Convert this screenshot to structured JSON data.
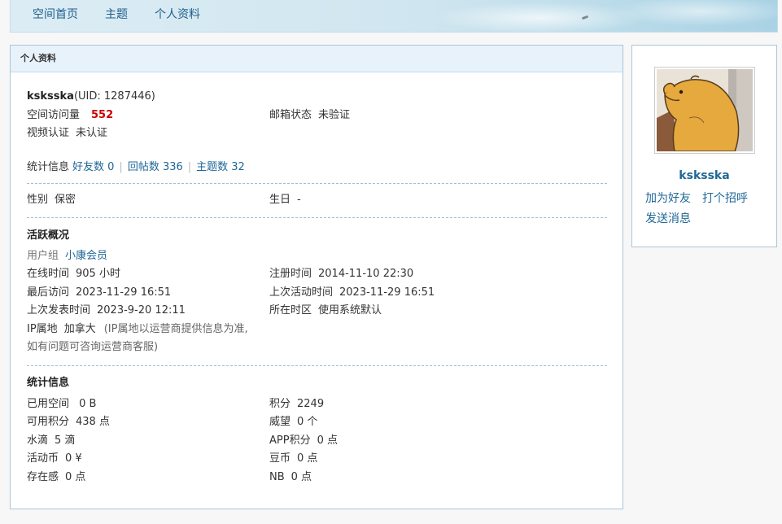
{
  "nav": {
    "items": [
      "空间首页",
      "主题",
      "个人资料"
    ]
  },
  "panel": {
    "title": "个人资料"
  },
  "user": {
    "name": "ksksska",
    "uid": "(UID: 1287446)",
    "visits_label": "空间访问量",
    "visits": "552",
    "email_label": "邮箱状态",
    "email_value": "未验证",
    "video_label": "视频认证",
    "video_value": "未认证"
  },
  "stats_line": {
    "label": "统计信息",
    "friends": "好友数 0",
    "replies": "回帖数 336",
    "topics": "主题数 32",
    "sep": "|"
  },
  "basic": {
    "gender_label": "性别",
    "gender_value": "保密",
    "birthday_label": "生日",
    "birthday_value": "-"
  },
  "activity": {
    "title": "活跃概况",
    "group_label": "用户组",
    "group_value": "小康会员",
    "online_label": "在线时间",
    "online_value": "905 小时",
    "register_label": "注册时间",
    "register_value": "2014-11-10 22:30",
    "last_visit_label": "最后访问",
    "last_visit_value": "2023-11-29 16:51",
    "last_active_label": "上次活动时间",
    "last_active_value": "2023-11-29 16:51",
    "last_post_label": "上次发表时间",
    "last_post_value": "2023-9-20 12:11",
    "timezone_label": "所在时区",
    "timezone_value": "使用系统默认",
    "ip_label": "IP属地",
    "ip_value": "加拿大",
    "ip_note_1": "(IP属地以运营商提供信息为准,",
    "ip_note_2": "如有问题可咨询运营商客服)"
  },
  "statistics": {
    "title": "统计信息",
    "rows": [
      {
        "l_label": "已用空间",
        "l_value": " 0 B",
        "r_label": "积分",
        "r_value": "2249"
      },
      {
        "l_label": "可用积分",
        "l_value": "438 点",
        "r_label": "威望",
        "r_value": "0 个"
      },
      {
        "l_label": "水滴",
        "l_value": "5 滴",
        "r_label": "APP积分",
        "r_value": "0 点"
      },
      {
        "l_label": "活动币",
        "l_value": "0 ¥",
        "r_label": "豆币",
        "r_value": "0 点"
      },
      {
        "l_label": "存在感",
        "l_value": "0 点",
        "r_label": "NB",
        "r_value": "0 点"
      }
    ]
  },
  "side": {
    "name": "ksksska",
    "add_friend": "加为好友",
    "greet": "打个招呼",
    "message": "发送消息"
  }
}
